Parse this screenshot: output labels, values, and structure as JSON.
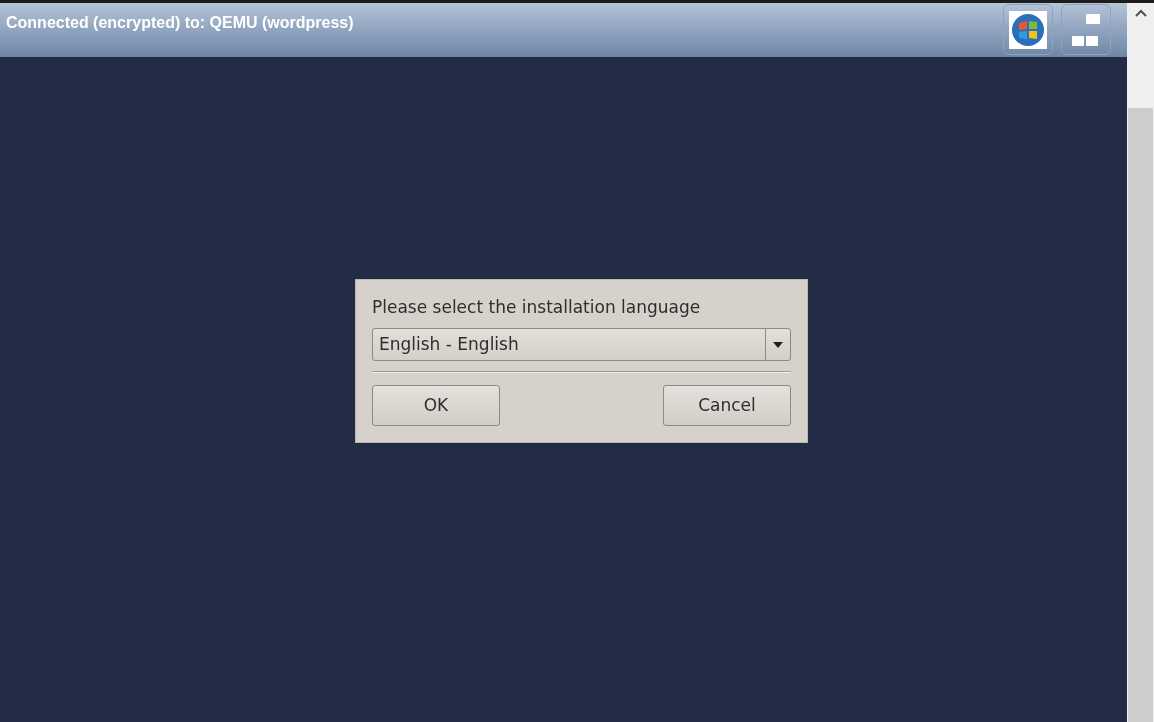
{
  "window": {
    "title": "Connected (encrypted) to: QEMU (wordpress)"
  },
  "dialog": {
    "prompt": "Please select the installation language",
    "language_select": {
      "value": "English - English"
    },
    "buttons": [
      "OK",
      "Cancel"
    ]
  }
}
